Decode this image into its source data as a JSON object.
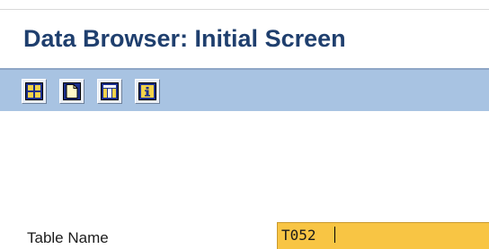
{
  "window": {
    "title": "Data Browser: Initial Screen"
  },
  "toolbar": {
    "buttons": [
      {
        "icon": "table-contents-icon"
      },
      {
        "icon": "new-document-icon"
      },
      {
        "icon": "table-columns-icon"
      },
      {
        "icon": "info-icon"
      }
    ]
  },
  "form": {
    "table_name_label": "Table Name",
    "table_name_value": "T052"
  },
  "colors": {
    "title_text": "#1f3f6e",
    "toolbar_bg": "#a8c3e2",
    "required_field_bg": "#f8c544"
  }
}
